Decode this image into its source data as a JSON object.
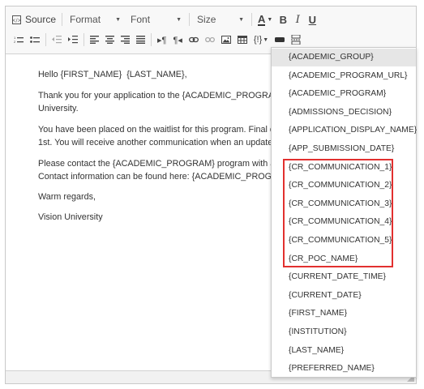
{
  "toolbar": {
    "source_label": "Source",
    "format_label": "Format",
    "font_label": "Font",
    "size_label": "Size",
    "text_color_label": "A",
    "bold_label": "B",
    "italic_label": "I",
    "underline_label": "U",
    "placeholder_menu_label": "{!}",
    "row2_icons": [
      "numbered-list-icon",
      "bulleted-list-icon",
      "outdent-icon",
      "indent-icon",
      "align-left-icon",
      "align-center-icon",
      "align-right-icon",
      "justify-icon",
      "ltr-icon",
      "rtl-icon",
      "link-icon",
      "unlink-icon",
      "image-icon",
      "table-icon",
      "placeholder-menu-icon",
      "horizontal-rule-icon",
      "page-break-icon"
    ]
  },
  "content": {
    "greeting": "Hello {FIRST_NAME}  {LAST_NAME},",
    "para1_line1": "Thank you for your application to the {ACADEMIC_PROGRAM}",
    "para1_line2": "University.",
    "para2_line1": "You have been placed on the waitlist for this program. Final dec",
    "para2_line2": "1st. You will receive another communication when an updated d",
    "para3_line1": "Please contact the {ACADEMIC_PROGRAM} program with any",
    "para3_line2": "Contact information can be found here: {ACADEMIC_PROGRA",
    "closing": "Warm regards,",
    "signature": "Vision University"
  },
  "dropdown": {
    "items": [
      "{ACADEMIC_GROUP}",
      "{ACADEMIC_PROGRAM_URL}",
      "{ACADEMIC_PROGRAM}",
      "{ADMISSIONS_DECISION}",
      "{APPLICATION_DISPLAY_NAME}",
      "{APP_SUBMISSION_DATE}",
      "{CR_COMMUNICATION_1}",
      "{CR_COMMUNICATION_2}",
      "{CR_COMMUNICATION_3}",
      "{CR_COMMUNICATION_4}",
      "{CR_COMMUNICATION_5}",
      "{CR_POC_NAME}",
      "{CURRENT_DATE_TIME}",
      "{CURRENT_DATE}",
      "{FIRST_NAME}",
      "{INSTITUTION}",
      "{LAST_NAME}",
      "{PREFERRED_NAME}"
    ],
    "hovered_item": "{ACADEMIC_GROUP}"
  },
  "colors": {
    "highlight_box": "#e2302f",
    "toolbar_bg": "#f8f8f8",
    "dropdown_hover": "#e6e6e6"
  }
}
